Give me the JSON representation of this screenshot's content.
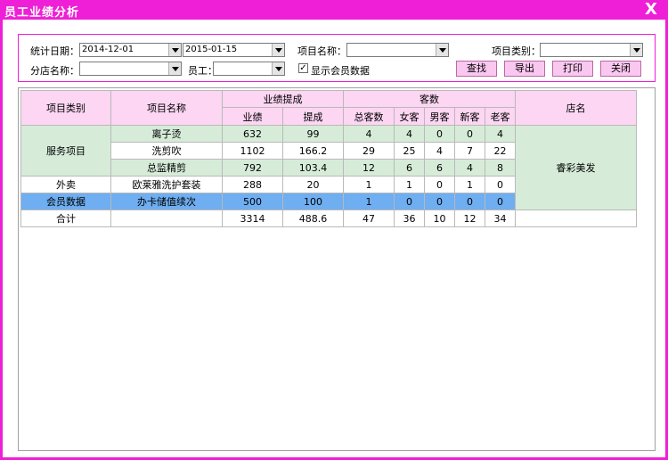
{
  "window": {
    "title": "员工业绩分析",
    "close_label": "X"
  },
  "filters": {
    "date_label": "统计日期：",
    "date_from": "2014-12-01",
    "date_to": "2015-01-15",
    "item_name_label": "项目名称：",
    "item_name_value": "",
    "item_type_label": "项目类别：",
    "item_type_value": "",
    "branch_label": "分店名称：",
    "branch_value": "",
    "staff_label": "员工：",
    "staff_value": "",
    "show_member_label": "显示会员数据",
    "show_member_checked": "✓"
  },
  "buttons": {
    "search": "查找",
    "export": "导出",
    "print": "打印",
    "close": "关闭"
  },
  "table": {
    "headers": {
      "category": "项目类别",
      "item_name": "项目名称",
      "performance_group": "业绩提成",
      "performance": "业绩",
      "commission": "提成",
      "customers_group": "客数",
      "total": "总客数",
      "female": "女客",
      "male": "男客",
      "new": "新客",
      "old": "老客",
      "store": "店名"
    },
    "store_name": "睿彩美发",
    "rows": [
      {
        "category": "服务项目",
        "name": "离子烫",
        "performance": "632",
        "commission": "99",
        "total": "4",
        "female": "4",
        "male": "0",
        "new": "0",
        "old": "4"
      },
      {
        "category": "",
        "name": "洗剪吹",
        "performance": "1102",
        "commission": "166.2",
        "total": "29",
        "female": "25",
        "male": "4",
        "new": "7",
        "old": "22"
      },
      {
        "category": "",
        "name": "总监精剪",
        "performance": "792",
        "commission": "103.4",
        "total": "12",
        "female": "6",
        "male": "6",
        "new": "4",
        "old": "8"
      },
      {
        "category": "外卖",
        "name": "欧莱雅洗护套装",
        "performance": "288",
        "commission": "20",
        "total": "1",
        "female": "1",
        "male": "0",
        "new": "1",
        "old": "0"
      },
      {
        "category": "会员数据",
        "name": "办卡储值续次",
        "performance": "500",
        "commission": "100",
        "total": "1",
        "female": "0",
        "male": "0",
        "new": "0",
        "old": "0"
      },
      {
        "category": "合计",
        "name": "",
        "performance": "3314",
        "commission": "488.6",
        "total": "47",
        "female": "36",
        "male": "10",
        "new": "12",
        "old": "34",
        "store": ""
      }
    ]
  }
}
